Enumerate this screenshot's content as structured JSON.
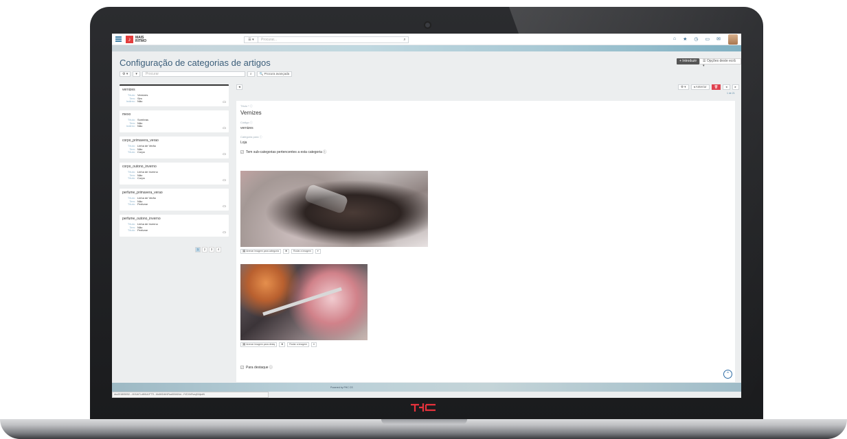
{
  "topbar": {
    "brand_line1": "MAIS",
    "brand_line2": "RITMO",
    "search_select": "☰ ▾",
    "search_placeholder": "Procurar...",
    "icons": [
      "home-icon",
      "star-icon",
      "clock-icon",
      "calendar-icon",
      "chat-icon"
    ]
  },
  "page": {
    "title": "Configuração de categorias de artigos",
    "new_button": "+ Introduzir",
    "options_button": "☰ Opções deste ecrã ▾"
  },
  "filters": {
    "gear": "⚙ ▾",
    "down": "▾",
    "placeholder": "Procurar",
    "advanced": "🔍 Procura avançada"
  },
  "list": [
    {
      "title": "vernizes",
      "rows": [
        [
          "Título:",
          "Vernizes"
        ],
        [
          "Tem:",
          "Sim"
        ],
        [
          "Indirec:",
          "Não"
        ]
      ]
    },
    {
      "title": "mexo",
      "rows": [
        [
          "Título:",
          "Sombras"
        ],
        [
          "Tem:",
          "Não"
        ],
        [
          "Indirec:",
          "Não"
        ]
      ]
    },
    {
      "title": "corpo_primavera_verao",
      "rows": [
        [
          "Título:",
          "Linha de Verão"
        ],
        [
          "Tem:",
          "Não"
        ],
        [
          "Título:",
          "Corpo"
        ]
      ]
    },
    {
      "title": "corpo_outono_inverno",
      "rows": [
        [
          "Título:",
          "Linha de Inverno"
        ],
        [
          "Tem:",
          "Não"
        ],
        [
          "Título:",
          "Corpo"
        ]
      ]
    },
    {
      "title": "perfume_primavera_verao",
      "rows": [
        [
          "Título:",
          "Linha de Verão"
        ],
        [
          "Tem:",
          "Não"
        ],
        [
          "Título:",
          "Perfume"
        ]
      ]
    },
    {
      "title": "perfume_outono_inverno",
      "rows": [
        [
          "Título:",
          "Linha de Inverno"
        ],
        [
          "Tem:",
          "Não"
        ],
        [
          "Título:",
          "Perfume"
        ]
      ]
    }
  ],
  "pager": [
    "1",
    "2",
    "3",
    "4"
  ],
  "detail": {
    "toolbar": {
      "back": "◂",
      "gear": "⚙ ▾",
      "prev": "◂ Anterior",
      "delete": "🗑",
      "left": "◂",
      "right": "▸"
    },
    "count": "1 de 21",
    "title_label": "Título * ⓘ",
    "title_value": "Vernizes",
    "code_label": "Código ⓘ",
    "code_value": "vernizes",
    "category_label": "Categoria para ⓘ",
    "category_value": "Loja",
    "sub_check": "Tem sub-categorias pertencentes a esta categoria ⓘ",
    "img1_tools": [
      "🖼 Anexar imagem para categoria",
      "✖",
      "Rodar a imagem",
      "▾"
    ],
    "img2_tools": [
      "🖼 Anexar imagem para destq",
      "✖",
      "Rodar a imagem",
      "▾"
    ],
    "highlight": "Para destaque ⓘ"
  },
  "footer": {
    "powered": "Powered by PHC CS",
    "status": "dsc201805052...//f/JUkTLdt5Kd1FTTi...Mx8KD4tNFkaKKM4Nd...YVDVhRvwjKl4lpdN"
  },
  "scroll_up": "⌃"
}
